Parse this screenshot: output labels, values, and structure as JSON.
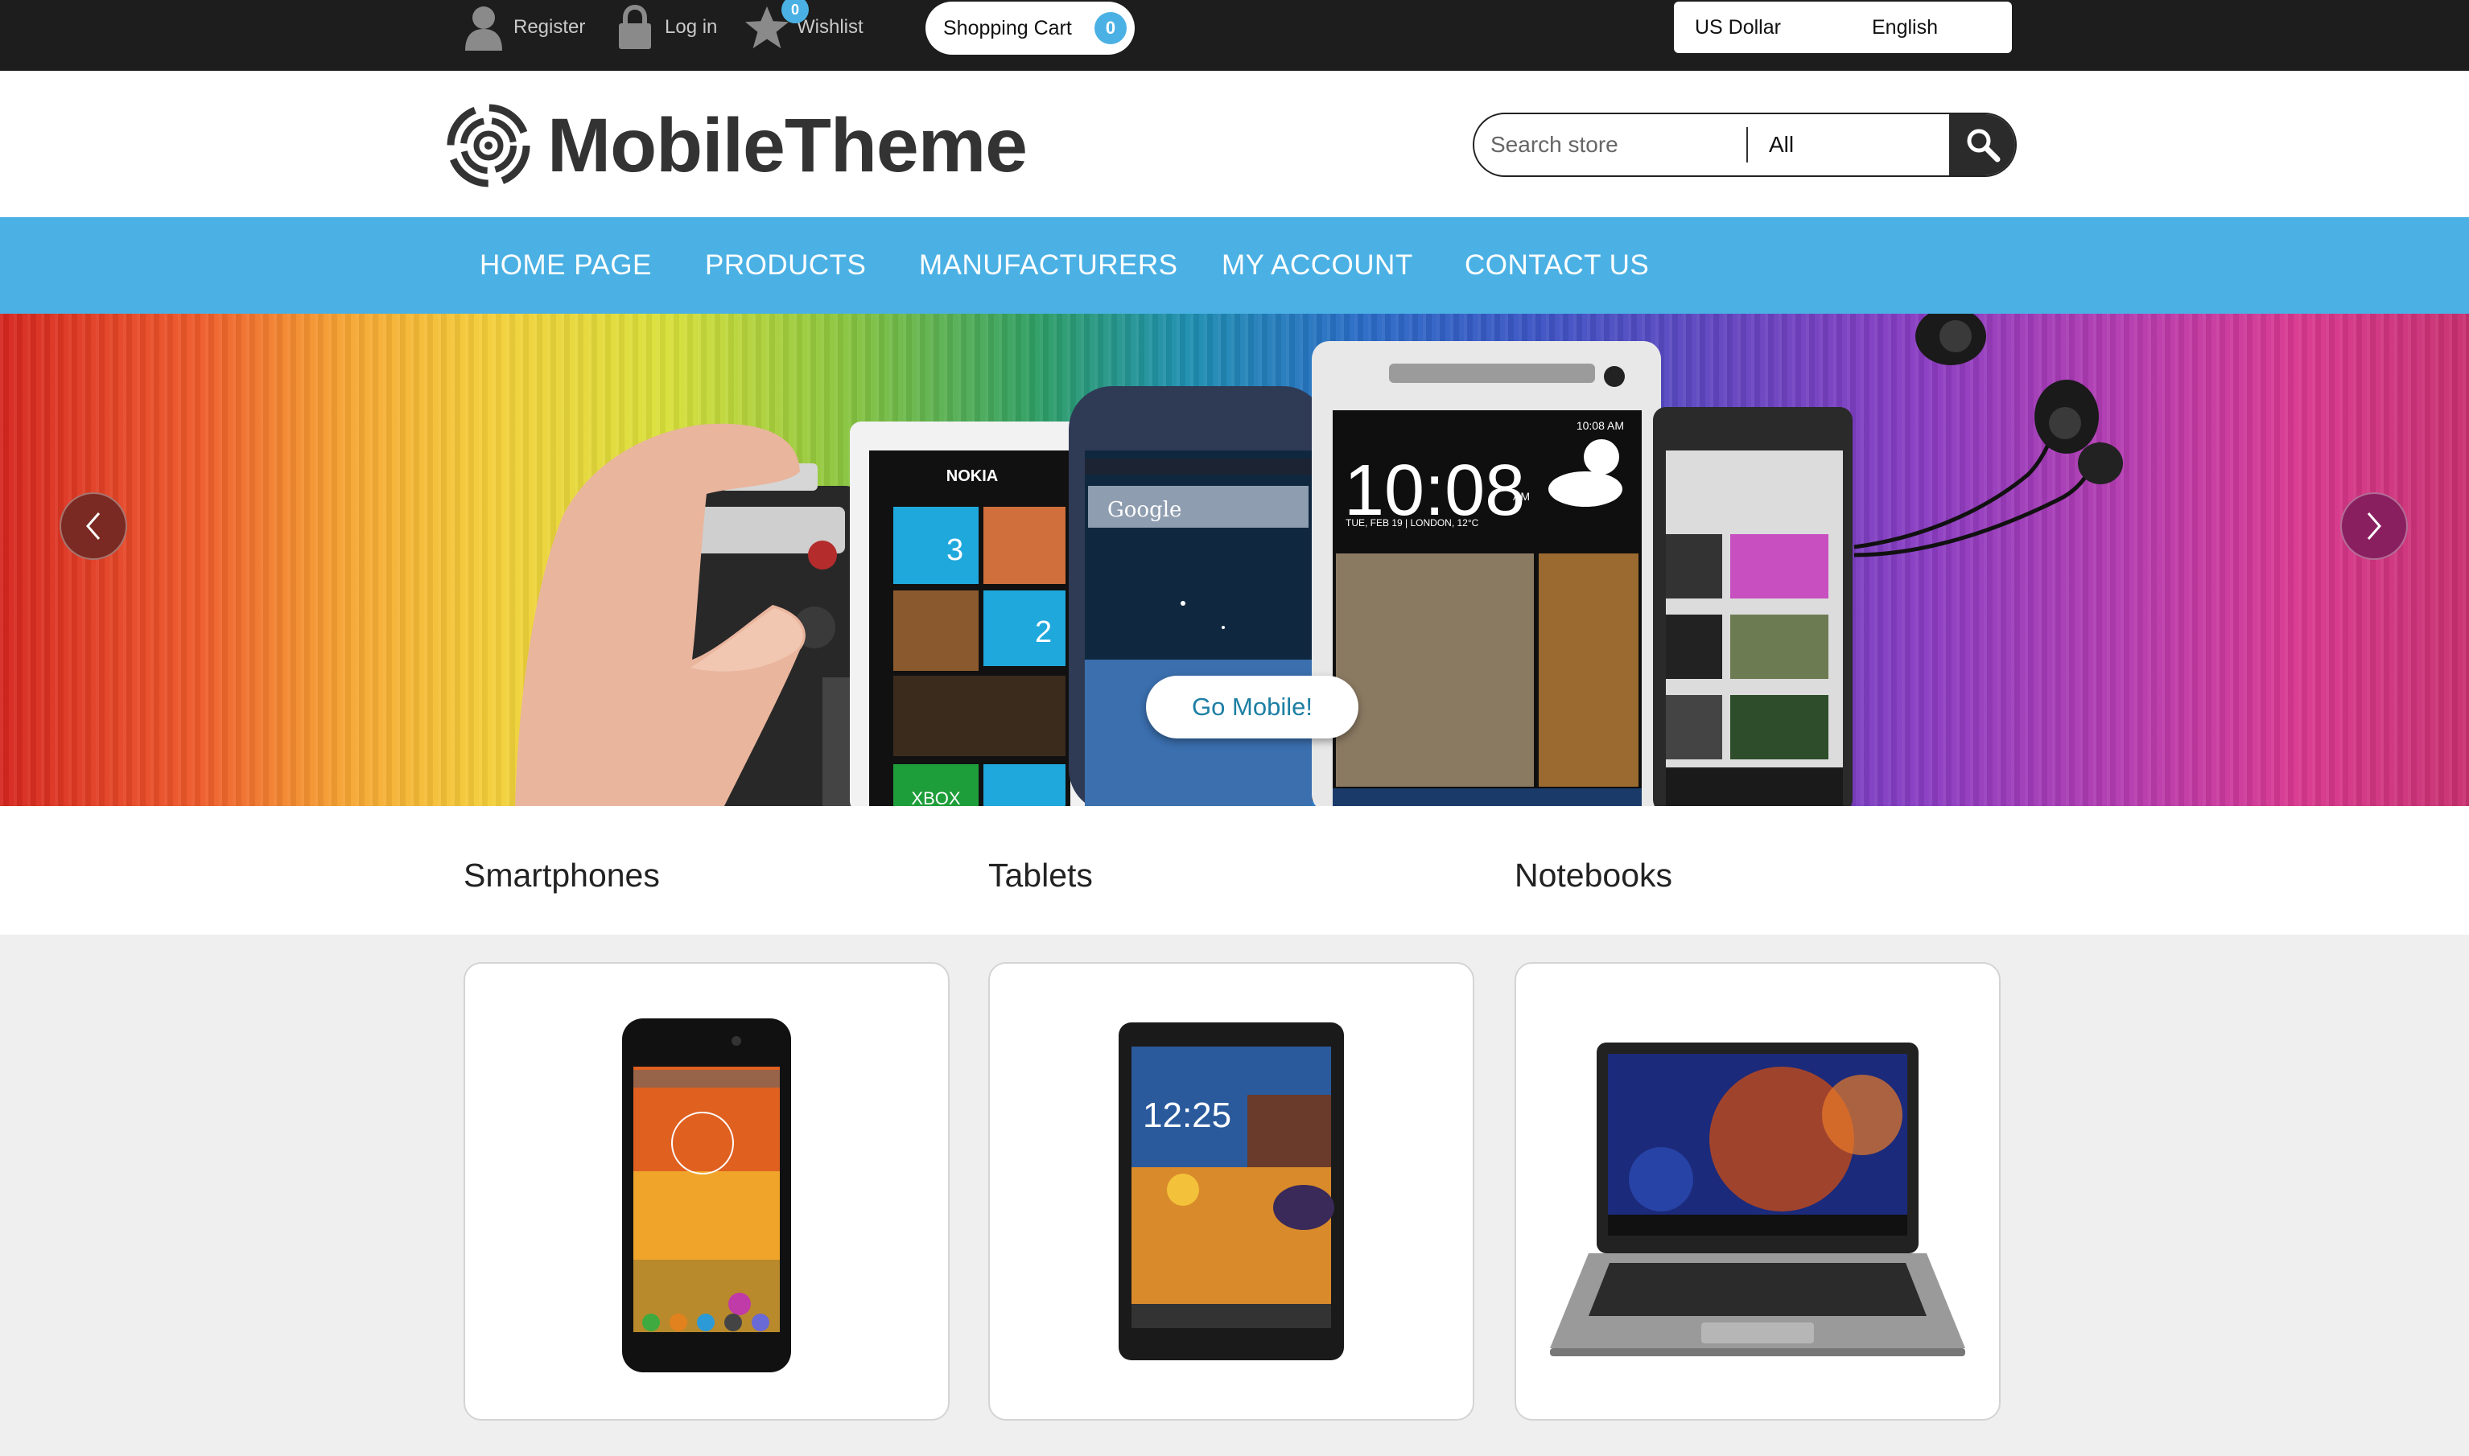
{
  "topbar": {
    "register_label": "Register",
    "login_label": "Log in",
    "wishlist_label": "Wishlist",
    "wishlist_count": "0",
    "cart_label": "Shopping Cart",
    "cart_count": "0",
    "currency": "US Dollar",
    "language": "English"
  },
  "header": {
    "logo_text": "MobileTheme",
    "search_placeholder": "Search store",
    "search_scope": "All"
  },
  "nav": {
    "items": [
      "HOME PAGE",
      "PRODUCTS",
      "MANUFACTURERS",
      "MY ACCOUNT",
      "CONTACT US"
    ]
  },
  "banner": {
    "cta_label": "Go Mobile!",
    "phone_brand": "NOKIA",
    "clock": "10:08",
    "clock_ampm": "AM",
    "date_line": "TUE, FEB 19 | LONDON, 12°C",
    "search_label": "Google",
    "status_time": "10:08 AM",
    "tile_count_1": "3",
    "tile_count_2": "2",
    "xbox_label": "XBOX"
  },
  "categories": [
    {
      "title": "Smartphones"
    },
    {
      "title": "Tablets",
      "device_time": "12:25"
    },
    {
      "title": "Notebooks"
    }
  ],
  "colors": {
    "accent": "#4bb1e4",
    "topbar": "#1d1d1d",
    "cta_text": "#1d7fa3"
  }
}
